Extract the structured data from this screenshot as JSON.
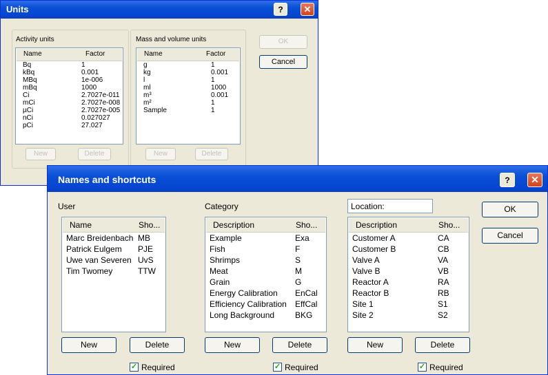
{
  "units_dialog": {
    "title": "Units",
    "help_label": "?",
    "close_label": "✕",
    "activity_group": "Activity units",
    "mass_group": "Mass and volume units",
    "col_name": "Name",
    "col_factor": "Factor",
    "activity_rows": [
      {
        "name": "Bq",
        "factor": "1"
      },
      {
        "name": "kBq",
        "factor": "0.001"
      },
      {
        "name": "MBq",
        "factor": "1e-006"
      },
      {
        "name": "mBq",
        "factor": "1000"
      },
      {
        "name": "Ci",
        "factor": "2.7027e-011"
      },
      {
        "name": "mCi",
        "factor": "2.7027e-008"
      },
      {
        "name": "µCi",
        "factor": "2.7027e-005"
      },
      {
        "name": "nCi",
        "factor": "0.027027"
      },
      {
        "name": "pCi",
        "factor": "27.027"
      }
    ],
    "mass_rows": [
      {
        "name": "g",
        "factor": "1"
      },
      {
        "name": "kg",
        "factor": "0.001"
      },
      {
        "name": "l",
        "factor": "1"
      },
      {
        "name": "ml",
        "factor": "1000"
      },
      {
        "name": "m³",
        "factor": "0.001"
      },
      {
        "name": "m²",
        "factor": "1"
      },
      {
        "name": "Sample",
        "factor": "1"
      }
    ],
    "ok_label": "OK",
    "cancel_label": "Cancel",
    "new_label": "New",
    "delete_label": "Delete"
  },
  "names_dialog": {
    "title": "Names and shortcuts",
    "help_label": "?",
    "close_label": "✕",
    "ok_label": "OK",
    "cancel_label": "Cancel",
    "new_label": "New",
    "delete_label": "Delete",
    "required_label": "Required",
    "check_mark": "✓",
    "user": {
      "group": "User",
      "col1": "Name",
      "col2": "Sho...",
      "rows": [
        {
          "c1": "Marc Breidenbach",
          "c2": "MB"
        },
        {
          "c1": "Patrick Eulgem",
          "c2": "PJE"
        },
        {
          "c1": "Uwe van Severen",
          "c2": "UvS"
        },
        {
          "c1": "Tim Twomey",
          "c2": "TTW"
        }
      ]
    },
    "category": {
      "group": "Category",
      "col1": "Description",
      "col2": "Sho...",
      "rows": [
        {
          "c1": "Example",
          "c2": "Exa"
        },
        {
          "c1": "Fish",
          "c2": "F"
        },
        {
          "c1": "Shrimps",
          "c2": "S"
        },
        {
          "c1": "Meat",
          "c2": "M"
        },
        {
          "c1": "Grain",
          "c2": "G"
        },
        {
          "c1": "Energy Calibration",
          "c2": "EnCal"
        },
        {
          "c1": "Efficiency Calibration",
          "c2": "EffCal"
        },
        {
          "c1": "Long Background",
          "c2": "BKG"
        }
      ]
    },
    "location": {
      "group": "Location:",
      "col1": "Description",
      "col2": "Sho...",
      "rows": [
        {
          "c1": "Customer A",
          "c2": "CA"
        },
        {
          "c1": "Customer B",
          "c2": "CB"
        },
        {
          "c1": "Valve A",
          "c2": "VA"
        },
        {
          "c1": "Valve B",
          "c2": "VB"
        },
        {
          "c1": "Reactor A",
          "c2": "RA"
        },
        {
          "c1": "Reactor B",
          "c2": "RB"
        },
        {
          "c1": "Site 1",
          "c2": "S1"
        },
        {
          "c1": "Site 2",
          "c2": "S2"
        }
      ]
    }
  }
}
